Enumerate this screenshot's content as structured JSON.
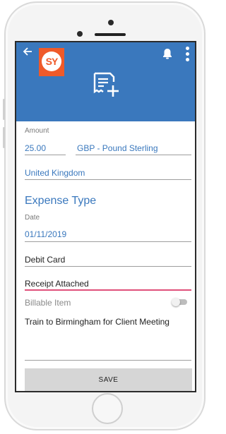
{
  "header": {
    "logo_text": "SY",
    "colors": {
      "header_bg": "#3a78bd",
      "logo_bg": "#ef5a2a"
    },
    "icons": {
      "back": "arrow-left",
      "notifications": "bell",
      "more": "more-vertical",
      "receipt": "receipt-add"
    }
  },
  "form": {
    "amount_label": "Amount",
    "amount_value": "25.00",
    "currency_value": "GBP - Pound Sterling",
    "country_value": "United Kingdom",
    "expense_type_title": "Expense Type",
    "date_label": "Date",
    "date_value": "01/11/2019",
    "payment_value": "Debit Card",
    "receipt_value": "Receipt Attached",
    "billable_label": "Billable Item",
    "billable_on": false,
    "description_value": "Train to Birmingham for Client Meeting"
  },
  "actions": {
    "save_label": "SAVE"
  }
}
